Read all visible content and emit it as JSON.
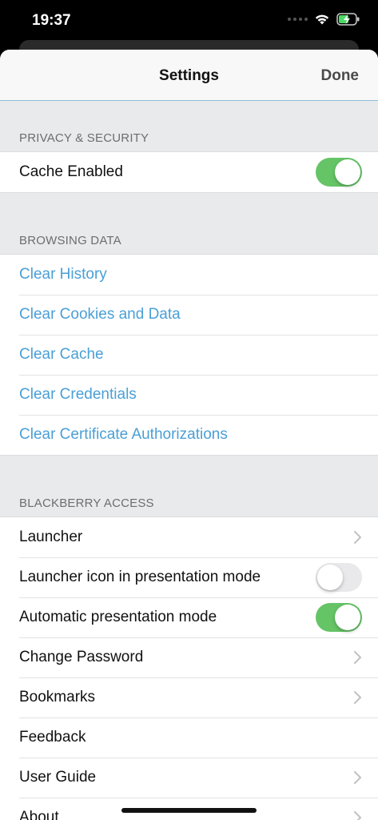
{
  "status": {
    "time": "19:37"
  },
  "nav": {
    "title": "Settings",
    "done": "Done"
  },
  "sections": {
    "privacy": {
      "header": "PRIVACY & SECURITY",
      "cache_enabled": {
        "label": "Cache Enabled",
        "value": true
      }
    },
    "browsing": {
      "header": "BROWSING DATA",
      "items": [
        "Clear History",
        "Clear Cookies and Data",
        "Clear Cache",
        "Clear Credentials",
        "Clear Certificate Authorizations"
      ]
    },
    "access": {
      "header": "BLACKBERRY ACCESS",
      "launcher": "Launcher",
      "launcher_icon": {
        "label": "Launcher icon in presentation mode",
        "value": false
      },
      "auto_presentation": {
        "label": "Automatic presentation mode",
        "value": true
      },
      "change_password": "Change Password",
      "bookmarks": "Bookmarks",
      "feedback": "Feedback",
      "user_guide": "User Guide",
      "about": "About"
    }
  },
  "colors": {
    "link": "#4a9fd5",
    "toggle_on": "#65c466",
    "battery": "#4cd964"
  }
}
